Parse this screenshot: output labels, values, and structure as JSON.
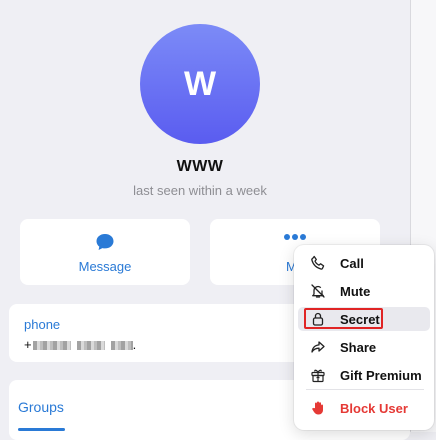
{
  "profile": {
    "avatar_letter": "W",
    "name": "WWW",
    "status": "last seen within a week"
  },
  "actions": {
    "message_label": "Message",
    "more_label": "Mo"
  },
  "info": {
    "phone_label": "phone",
    "phone_value_prefix": "+",
    "phone_value_suffix": "."
  },
  "tabs": {
    "groups_label": "Groups"
  },
  "menu": {
    "items": [
      {
        "label": "Call",
        "icon": "phone-icon"
      },
      {
        "label": "Mute",
        "icon": "bell-off-icon"
      },
      {
        "label": "Secret",
        "icon": "lock-icon"
      },
      {
        "label": "Share",
        "icon": "share-icon"
      },
      {
        "label": "Gift Premium",
        "icon": "gift-icon"
      },
      {
        "label": "Block User",
        "icon": "hand-icon"
      }
    ]
  },
  "colors": {
    "accent": "#2a7ad6",
    "danger": "#e53935",
    "avatar_top": "#7c8bf7",
    "avatar_bottom": "#5a5cf0",
    "highlight": "#e02424"
  }
}
